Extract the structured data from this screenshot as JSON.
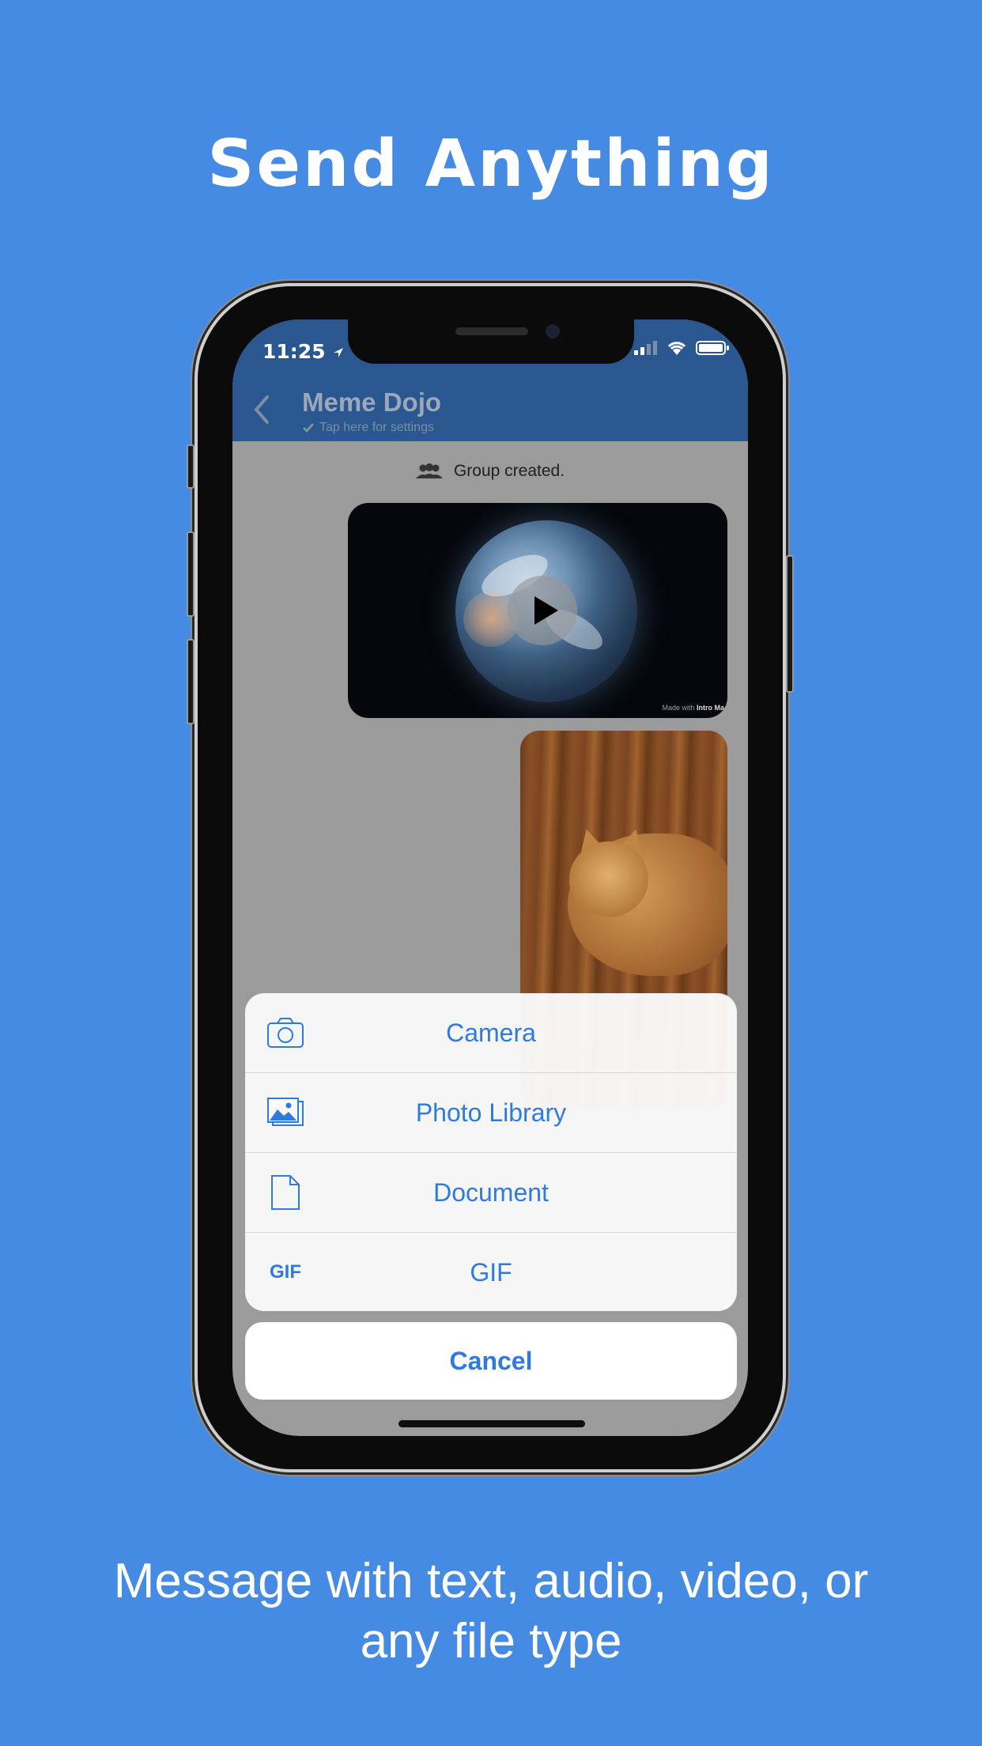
{
  "promo": {
    "headline": "Send Anything",
    "subline": "Message with text, audio, video, or any file type"
  },
  "status_bar": {
    "time": "11:25"
  },
  "chat": {
    "title": "Meme Dojo",
    "subtitle": "Tap here for settings",
    "system_message": "Group created.",
    "video_watermark_prefix": "Made with",
    "video_watermark_brand": "Intro Ma"
  },
  "action_sheet": {
    "items": [
      {
        "label": "Camera",
        "icon": "camera-icon"
      },
      {
        "label": "Photo Library",
        "icon": "photo-library-icon"
      },
      {
        "label": "Document",
        "icon": "document-icon"
      },
      {
        "label": "GIF",
        "icon": "gif-icon",
        "icon_text": "GIF"
      }
    ],
    "cancel_label": "Cancel"
  },
  "colors": {
    "background": "#468be3",
    "nav_bar": "#2b5790",
    "accent": "#2f7ae0"
  }
}
